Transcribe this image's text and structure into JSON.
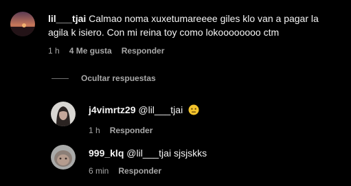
{
  "comments": [
    {
      "username": "lil___tjai",
      "text": "Calmao noma xuxetumareeee giles klo van a pagar la agila k isiero. Con mi reina toy como lokoooooooo ctm",
      "time": "1 h",
      "likes": "4 Me gusta",
      "reply_label": "Responder"
    }
  ],
  "replies_toggle": {
    "label": "Ocultar respuestas"
  },
  "replies": [
    {
      "username": "j4vimrtz29",
      "text": "@lil___tjai",
      "emoji": "neutral-face-emoji",
      "time": "1 h",
      "reply_label": "Responder"
    },
    {
      "username": "999_klq",
      "text": "@lil___tjai sjsjskks",
      "time": "6 min",
      "reply_label": "Responder"
    }
  ],
  "colors": {
    "background": "#000000",
    "text": "#f5f5f5",
    "secondary": "#a8a8a8",
    "emoji": "#f2c32c"
  }
}
